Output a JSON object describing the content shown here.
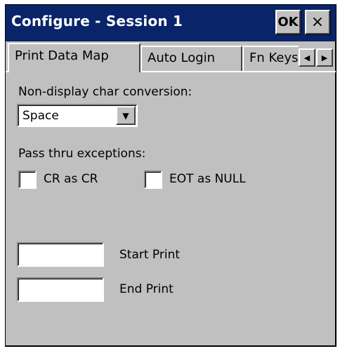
{
  "window": {
    "title": "Configure - Session 1",
    "ok_label": "OK",
    "close_label": "×"
  },
  "tabs": [
    {
      "label": "Print Data Map",
      "active": true
    },
    {
      "label": "Auto Login",
      "active": false
    },
    {
      "label": "Fn Keys",
      "active": false
    }
  ],
  "tab_scroll": {
    "left_icon": "◀",
    "right_icon": "▶"
  },
  "form": {
    "nondisplay_label": "Non-display char conversion:",
    "nondisplay_value": "Space",
    "dropdown_icon": "▼",
    "passthru_label": "Pass thru exceptions:",
    "cr_label": "CR as CR",
    "cr_checked": false,
    "eot_label": "EOT as NULL",
    "eot_checked": false,
    "start_print_value": "",
    "start_print_label": "Start Print",
    "end_print_value": "",
    "end_print_label": "End Print"
  },
  "colors": {
    "titlebar": "#0a246a",
    "face": "#c0c0c0"
  }
}
